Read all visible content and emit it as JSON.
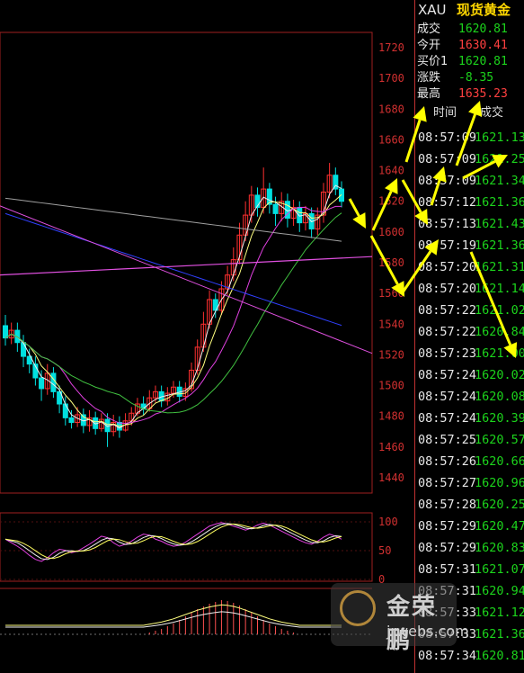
{
  "header": {
    "code": "XAU",
    "name": "现货黄金"
  },
  "quotes": [
    {
      "label": "成交",
      "value": "1620.81",
      "color": "#1cd41c"
    },
    {
      "label": "今开",
      "value": "1630.41",
      "color": "#ff4040"
    },
    {
      "label": "买价1",
      "value": "1620.81",
      "color": "#1cd41c"
    },
    {
      "label": "涨跌",
      "value": "-8.35",
      "color": "#1cd41c"
    },
    {
      "label": "最高",
      "value": "1635.23",
      "color": "#ff4040"
    }
  ],
  "tick_header": {
    "time": "时间",
    "price": "成交"
  },
  "ticks": [
    {
      "time": "08:57:09",
      "price": "1621.13"
    },
    {
      "time": "08:57:09",
      "price": "1621.25"
    },
    {
      "time": "08:57:09",
      "price": "1621.34"
    },
    {
      "time": "08:57:12",
      "price": "1621.36"
    },
    {
      "time": "08:57:13",
      "price": "1621.43"
    },
    {
      "time": "08:57:19",
      "price": "1621.36"
    },
    {
      "time": "08:57:20",
      "price": "1621.31"
    },
    {
      "time": "08:57:20",
      "price": "1621.14"
    },
    {
      "time": "08:57:22",
      "price": "1621.02"
    },
    {
      "time": "08:57:22",
      "price": "1620.84"
    },
    {
      "time": "08:57:23",
      "price": "1621.00"
    },
    {
      "time": "08:57:24",
      "price": "1620.02"
    },
    {
      "time": "08:57:24",
      "price": "1620.08"
    },
    {
      "time": "08:57:24",
      "price": "1620.39"
    },
    {
      "time": "08:57:25",
      "price": "1620.57"
    },
    {
      "time": "08:57:26",
      "price": "1620.66"
    },
    {
      "time": "08:57:27",
      "price": "1620.96"
    },
    {
      "time": "08:57:28",
      "price": "1620.25"
    },
    {
      "time": "08:57:29",
      "price": "1620.47"
    },
    {
      "time": "08:57:29",
      "price": "1620.83"
    },
    {
      "time": "08:57:31",
      "price": "1621.07"
    },
    {
      "time": "08:57:31",
      "price": "1620.94"
    },
    {
      "time": "08:57:33",
      "price": "1621.12"
    },
    {
      "time": "08:57:33",
      "price": "1621.36"
    },
    {
      "time": "08:57:34",
      "price": "1620.81"
    }
  ],
  "chart_data": {
    "type": "candlestick",
    "y_ticks": [
      "1720",
      "1700",
      "1680",
      "1660",
      "1640",
      "1620",
      "1600",
      "1580",
      "1560",
      "1540",
      "1520",
      "1500",
      "1480",
      "1460",
      "1440"
    ],
    "ylim": [
      1430,
      1730
    ],
    "indicator_ticks": [
      "100",
      "50",
      "0"
    ],
    "candles": [
      [
        1539,
        1531,
        1546,
        1526
      ],
      [
        1531,
        1536,
        1541,
        1527
      ],
      [
        1536,
        1528,
        1541,
        1522
      ],
      [
        1528,
        1519,
        1533,
        1512
      ],
      [
        1519,
        1514,
        1524,
        1508
      ],
      [
        1514,
        1505,
        1519,
        1500
      ],
      [
        1505,
        1498,
        1510,
        1490
      ],
      [
        1498,
        1508,
        1514,
        1494
      ],
      [
        1508,
        1496,
        1512,
        1492
      ],
      [
        1496,
        1488,
        1500,
        1482
      ],
      [
        1488,
        1479,
        1493,
        1474
      ],
      [
        1479,
        1476,
        1484,
        1472
      ],
      [
        1476,
        1481,
        1486,
        1473
      ],
      [
        1481,
        1474,
        1485,
        1469
      ],
      [
        1474,
        1479,
        1484,
        1470
      ],
      [
        1479,
        1472,
        1483,
        1468
      ],
      [
        1472,
        1478,
        1482,
        1470
      ],
      [
        1478,
        1470,
        1482,
        1460
      ],
      [
        1470,
        1476,
        1481,
        1467
      ],
      [
        1476,
        1471,
        1480,
        1466
      ],
      [
        1471,
        1477,
        1482,
        1470
      ],
      [
        1477,
        1482,
        1486,
        1474
      ],
      [
        1482,
        1488,
        1492,
        1480
      ],
      [
        1488,
        1485,
        1493,
        1481
      ],
      [
        1485,
        1492,
        1497,
        1483
      ],
      [
        1492,
        1496,
        1500,
        1489
      ],
      [
        1496,
        1490,
        1500,
        1486
      ],
      [
        1490,
        1495,
        1499,
        1487
      ],
      [
        1495,
        1499,
        1503,
        1492
      ],
      [
        1499,
        1493,
        1503,
        1489
      ],
      [
        1493,
        1498,
        1502,
        1490
      ],
      [
        1498,
        1510,
        1515,
        1496
      ],
      [
        1510,
        1525,
        1530,
        1507
      ],
      [
        1525,
        1540,
        1548,
        1522
      ],
      [
        1540,
        1556,
        1562,
        1537
      ],
      [
        1556,
        1549,
        1560,
        1544
      ],
      [
        1549,
        1563,
        1568,
        1546
      ],
      [
        1563,
        1572,
        1578,
        1559
      ],
      [
        1572,
        1582,
        1590,
        1568
      ],
      [
        1582,
        1598,
        1606,
        1579
      ],
      [
        1598,
        1611,
        1620,
        1594
      ],
      [
        1611,
        1624,
        1630,
        1606
      ],
      [
        1624,
        1616,
        1629,
        1610
      ],
      [
        1616,
        1628,
        1642,
        1612
      ],
      [
        1628,
        1618,
        1632,
        1612
      ],
      [
        1618,
        1612,
        1623,
        1604
      ],
      [
        1612,
        1620,
        1626,
        1607
      ],
      [
        1620,
        1609,
        1625,
        1603
      ],
      [
        1609,
        1616,
        1621,
        1604
      ],
      [
        1616,
        1606,
        1620,
        1600
      ],
      [
        1606,
        1612,
        1617,
        1601
      ],
      [
        1612,
        1602,
        1616,
        1596
      ],
      [
        1602,
        1611,
        1616,
        1598
      ],
      [
        1611,
        1626,
        1632,
        1606
      ],
      [
        1626,
        1637,
        1645,
        1622
      ],
      [
        1637,
        1628,
        1642,
        1624
      ],
      [
        1628,
        1620,
        1633,
        1616
      ]
    ],
    "indicator_levels": [
      62,
      55,
      48,
      40,
      30,
      22,
      18,
      25,
      35,
      42,
      40,
      35,
      38,
      45,
      52,
      60,
      68,
      65,
      55,
      48,
      52,
      58,
      66,
      72,
      70,
      62,
      58,
      52,
      48,
      50,
      56,
      64,
      72,
      80,
      88,
      92,
      95,
      92,
      88,
      84,
      80,
      84,
      90,
      94,
      90,
      84,
      78,
      72,
      66,
      60,
      55,
      52,
      58,
      66,
      72,
      68,
      62
    ],
    "macd_bars": [
      0,
      0,
      0,
      0,
      0,
      0,
      0,
      0,
      0,
      0,
      0,
      0,
      0,
      0,
      0,
      0,
      0,
      0,
      0,
      0,
      0,
      0,
      0,
      0,
      2,
      4,
      6,
      9,
      12,
      16,
      20,
      24,
      28,
      31,
      34,
      36,
      38,
      37,
      35,
      32,
      28,
      24,
      20,
      16,
      12,
      9,
      6,
      4,
      2,
      0,
      0,
      0,
      0,
      0,
      0,
      0,
      0
    ]
  },
  "watermark": {
    "brand": "金荣鹏",
    "url": "jrwebs.com"
  },
  "colors": {
    "up": "#ff3030",
    "down": "#00e0e0",
    "grid": "#a02020",
    "arrow": "#ffff00"
  }
}
